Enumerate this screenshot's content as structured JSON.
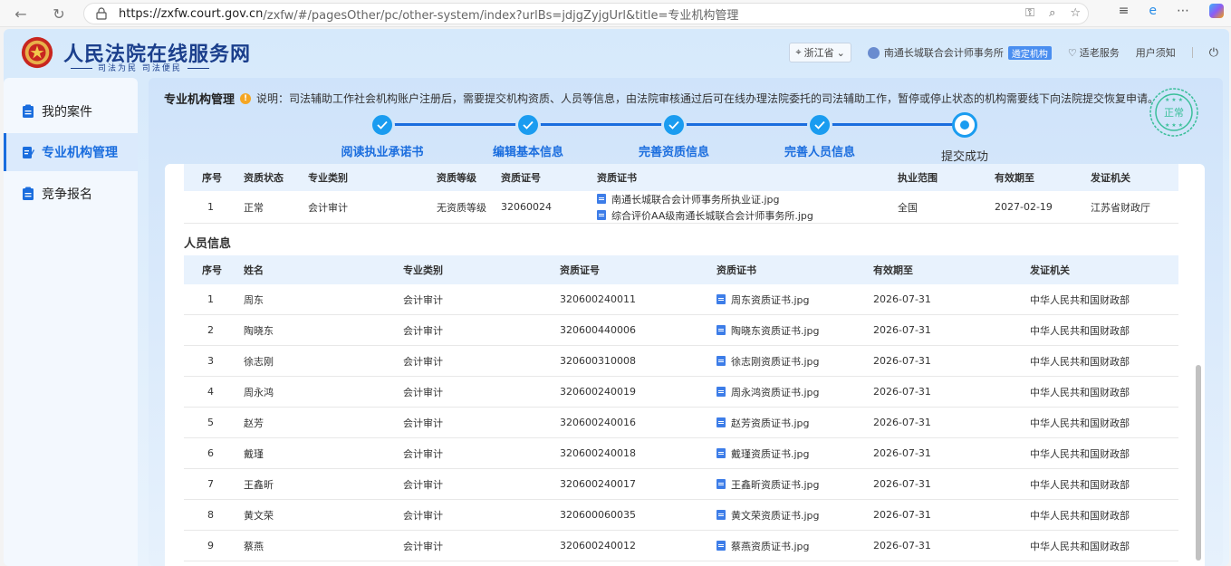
{
  "browser": {
    "url_host": "https://zxfw.court.gov.cn",
    "url_path": "/zxfw/#/pagesOther/pc/other-system/index?urlBs=jdjgZyjgUrl&title=专业机构管理"
  },
  "header": {
    "site_title": "人民法院在线服务网",
    "site_subtitle": "司法为民  司法便民",
    "region": "浙江省",
    "user_name": "南通长城联合会计师事务所",
    "user_badge": "遴定机构",
    "elder_service": "适老服务",
    "user_notice": "用户须知"
  },
  "sidebar": {
    "items": [
      {
        "label": "我的案件"
      },
      {
        "label": "专业机构管理"
      },
      {
        "label": "竞争报名"
      }
    ]
  },
  "notice": {
    "title": "专业机构管理",
    "text": "说明：司法辅助工作社会机构账户注册后，需要提交机构资质、人员等信息，由法院审核通过后可在线办理法院委托的司法辅助工作，暂停或停止状态的机构需要线下向法院提交恢复申请。"
  },
  "stamp": {
    "text": "正常",
    "color": "#3bbf9a"
  },
  "steps": [
    {
      "label": "阅读执业承诺书",
      "done": true
    },
    {
      "label": "编辑基本信息",
      "done": true
    },
    {
      "label": "完善资质信息",
      "done": true
    },
    {
      "label": "完善人员信息",
      "done": true
    },
    {
      "label": "提交成功",
      "done": false
    }
  ],
  "qualification_table": {
    "headers": [
      "序号",
      "资质状态",
      "专业类别",
      "资质等级",
      "资质证号",
      "资质证书",
      "执业范围",
      "有效期至",
      "发证机关"
    ],
    "rows": [
      {
        "no": "1",
        "status": "正常",
        "category": "会计审计",
        "level": "无资质等级",
        "cert_no": "32060024",
        "certs": [
          "南通长城联合会计师事务所执业证.jpg",
          "综合评价AA级南通长城联合会计师事务所.jpg"
        ],
        "scope": "全国",
        "expiry": "2027-02-19",
        "issuer": "江苏省财政厅"
      }
    ]
  },
  "personnel": {
    "section_title": "人员信息",
    "headers": [
      "序号",
      "姓名",
      "专业类别",
      "资质证号",
      "资质证书",
      "有效期至",
      "发证机关"
    ],
    "rows": [
      {
        "no": "1",
        "name": "周东",
        "category": "会计审计",
        "cert_no": "320600240011",
        "cert": "周东资质证书.jpg",
        "expiry": "2026-07-31",
        "issuer": "中华人民共和国财政部"
      },
      {
        "no": "2",
        "name": "陶晓东",
        "category": "会计审计",
        "cert_no": "320600440006",
        "cert": "陶晓东资质证书.jpg",
        "expiry": "2026-07-31",
        "issuer": "中华人民共和国财政部"
      },
      {
        "no": "3",
        "name": "徐志刚",
        "category": "会计审计",
        "cert_no": "320600310008",
        "cert": "徐志刚资质证书.jpg",
        "expiry": "2026-07-31",
        "issuer": "中华人民共和国财政部"
      },
      {
        "no": "4",
        "name": "周永鸿",
        "category": "会计审计",
        "cert_no": "320600240019",
        "cert": "周永鸿资质证书.jpg",
        "expiry": "2026-07-31",
        "issuer": "中华人民共和国财政部"
      },
      {
        "no": "5",
        "name": "赵芳",
        "category": "会计审计",
        "cert_no": "320600240016",
        "cert": "赵芳资质证书.jpg",
        "expiry": "2026-07-31",
        "issuer": "中华人民共和国财政部"
      },
      {
        "no": "6",
        "name": "戴瑾",
        "category": "会计审计",
        "cert_no": "320600240018",
        "cert": "戴瑾资质证书.jpg",
        "expiry": "2026-07-31",
        "issuer": "中华人民共和国财政部"
      },
      {
        "no": "7",
        "name": "王鑫昕",
        "category": "会计审计",
        "cert_no": "320600240017",
        "cert": "王鑫昕资质证书.jpg",
        "expiry": "2026-07-31",
        "issuer": "中华人民共和国财政部"
      },
      {
        "no": "8",
        "name": "黄文荣",
        "category": "会计审计",
        "cert_no": "320600060035",
        "cert": "黄文荣资质证书.jpg",
        "expiry": "2026-07-31",
        "issuer": "中华人民共和国财政部"
      },
      {
        "no": "9",
        "name": "蔡燕",
        "category": "会计审计",
        "cert_no": "320600240012",
        "cert": "蔡燕资质证书.jpg",
        "expiry": "2026-07-31",
        "issuer": "中华人民共和国财政部"
      }
    ]
  }
}
